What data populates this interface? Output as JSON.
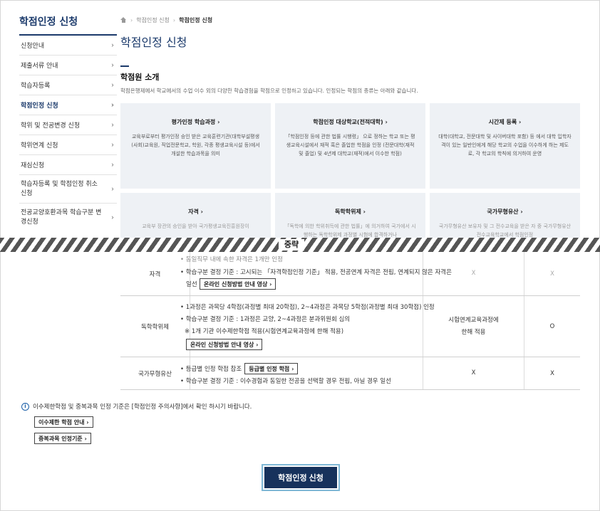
{
  "sidebar": {
    "title": "학점인정 신청",
    "items": [
      {
        "label": "신청안내"
      },
      {
        "label": "제출서류 안내"
      },
      {
        "label": "학습자등록"
      },
      {
        "label": "학점인정 신청"
      },
      {
        "label": "학위 및 전공변경 신청"
      },
      {
        "label": "학위연계 신청"
      },
      {
        "label": "재심신청"
      },
      {
        "label": "학습자등록 및 학점인정 취소 신청"
      },
      {
        "label": "전공교양호환과목 학습구분 변경신청"
      }
    ],
    "chevron": "›"
  },
  "breadcrumb": {
    "level1": "학점인정 신청",
    "current": "학점인정 신청",
    "separator": "›"
  },
  "page_title": "학점인정 신청",
  "section": {
    "title": "학점원 소개",
    "description": "학점은행제에서 학교에서의 수업 이수 외의 다양한 학습경험을 학점으로 인정하고 있습니다. 인정되는 학점의 종류는 아래와 같습니다."
  },
  "cards": [
    {
      "title": "평가인정 학습과정 ›",
      "desc": "교육부로부터 평가인정 승인 받은 교육훈련기관(대학부설평생(사회)교육원, 직업전문학교, 학원, 각종 평생교육시설 등)에서 개설한 학습과목을 의미"
    },
    {
      "title": "학점인정 대상학교(전적대학) ›",
      "desc": "「학점인정 등에 관한 법률 시행령」 으로 정하는 학교 또는 평생교육시설에서 재적 혹은 졸업한 학점을 인정 (전문대학(재적 및 졸업) 및 4년제 대학교(재적)에서 이수한 학점)"
    },
    {
      "title": "시간제 등록 ›",
      "desc": "대학(대학교, 전문대학 및 사이버대학 포함) 등 에서 대학 입학자격이 있는 일반인에게 해당 학교의 수업을 이수하게 하는 제도로, 각 학교의 학칙에 의거하여 운영"
    },
    {
      "title": "자격 ›",
      "desc": "교육부 장관의 승인을 받아 국가평생교육진흥원장이"
    },
    {
      "title": "독학학위제 ›",
      "desc": "「독학에 의한 학위취득에 관한 법률」에 의거하여 국가에서 시행하는 독학학위제 과정별 시험에 합격하거나"
    },
    {
      "title": "국가무형유산 ›",
      "desc": "국가무형유산 보유자 및 그 전수교육을 받은 자 중 국가무형유산 전수교육학교에서 학점인정"
    }
  ],
  "cut_label": "중략",
  "table": {
    "rows": [
      {
        "name": "자격",
        "lines": [
          "• 동일직무 내에 속한 자격은 1개만 인정",
          "• 학습구분 결정 기준 : 고시되는 「자격학점인정 기준」 적용, 전공연계 자격은 전핍, 연계되지 않은 자격은",
          "일선"
        ],
        "button": "온라인 신청방법 안내 영상 ›",
        "col3": "X",
        "col4": "X"
      },
      {
        "name": "독학학위제",
        "lines": [
          "• 1과정은 과목당 4학점(과정별 최대 20학점), 2~4과정은 과목당 5학점(과정별 최대 30학점) 인정",
          "• 학습구분 결정 기준 : 1과정은 교양, 2~4과정은 분과위원회 심의",
          "※ 1개 기관 이수제한학점 적용(시험연계교육과정에 한해 적용)"
        ],
        "button": "온라인 신청방법 안내 영상 ›",
        "col3a": "시험연계교육과정에",
        "col3b": "한해 적용",
        "col4": "O"
      },
      {
        "name": "국가무형유산",
        "line1": "• 등급별 인정 학점 참조",
        "button": "등급별 인정 학점 ›",
        "line2": "• 학습구분 결정 기준 : 이수경험과 동일한 전공을 선택할 경우 전핍, 아닐 경우 일선",
        "col3": "X",
        "col4": "X"
      }
    ]
  },
  "notes": {
    "text": "이수제한학점 및 중복과목 인정 기준은 [학점인정 주의사항]에서 확인 하시기 바랍니다.",
    "icon": "i",
    "buttons": [
      "이수제한 학점 안내 ›",
      "중복과목 인정기준 ›"
    ]
  },
  "apply_button": "학점인정 신청"
}
